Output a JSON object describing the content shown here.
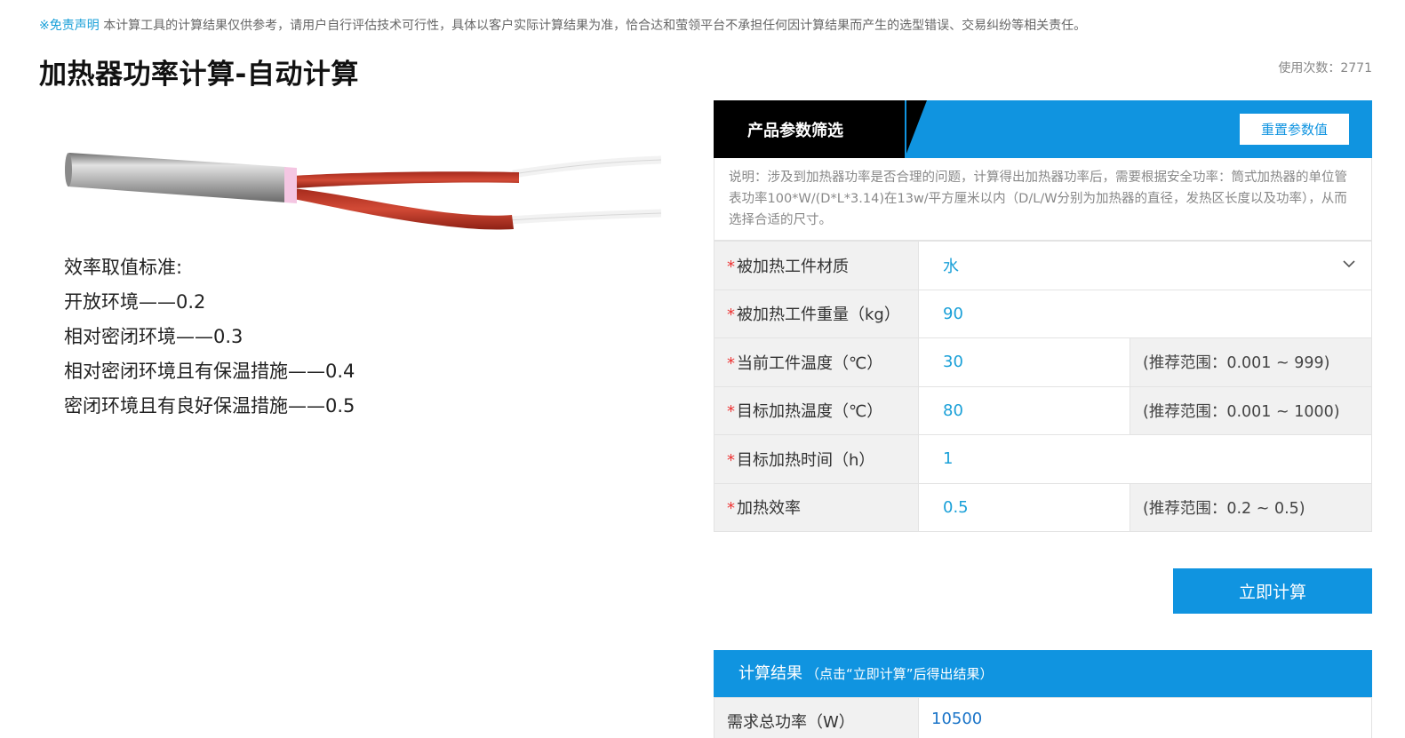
{
  "disclaimer": {
    "link": "※免责声明",
    "text": "本计算工具的计算结果仅供参考，请用户自行评估技术可行性，具体以客户实际计算结果为准，恰合达和萤领平台不承担任何因计算结果而产生的选型错误、交易纠纷等相关责任。"
  },
  "page_title": "加热器功率计算-自动计算",
  "usage": "使用次数：2771",
  "efficiency": {
    "heading": "效率取值标准:",
    "items": [
      "开放环境——0.2",
      "相对密闭环境——0.3",
      "相对密闭环境且有保温措施——0.4",
      "密闭环境且有良好保温措施——0.5"
    ]
  },
  "panel": {
    "tab_title": "产品参数筛选",
    "reset_label": "重置参数值",
    "note": "说明：涉及到加热器功率是否合理的问题，计算得出加热器功率后，需要根据安全功率：筒式加热器的单位管表功率100*W/(D*L*3.14)在13w/平方厘米以内（D/L/W分别为加热器的直径，发热区长度以及功率），从而选择合适的尺寸。",
    "required_mark": "*",
    "fields": [
      {
        "label": "被加热工件材质",
        "value": "水",
        "hint": ""
      },
      {
        "label": "被加热工件重量（kg）",
        "value": "90",
        "hint": ""
      },
      {
        "label": "当前工件温度（℃）",
        "value": "30",
        "hint": "(推荐范围：0.001 ~ 999)"
      },
      {
        "label": "目标加热温度（℃）",
        "value": "80",
        "hint": "(推荐范围：0.001 ~ 1000)"
      },
      {
        "label": "目标加热时间（h）",
        "value": "1",
        "hint": ""
      },
      {
        "label": "加热效率",
        "value": "0.5",
        "hint": "(推荐范围：0.2 ~ 0.5)"
      }
    ]
  },
  "calc_label": "立即计算",
  "result": {
    "title": "计算结果",
    "subtitle": "（点击“立即计算”后得出结果）",
    "label": "需求总功率（W）",
    "value": "10500"
  },
  "colors": {
    "accent": "#1094e0",
    "link": "#1aa0d8",
    "required": "#e33333"
  }
}
